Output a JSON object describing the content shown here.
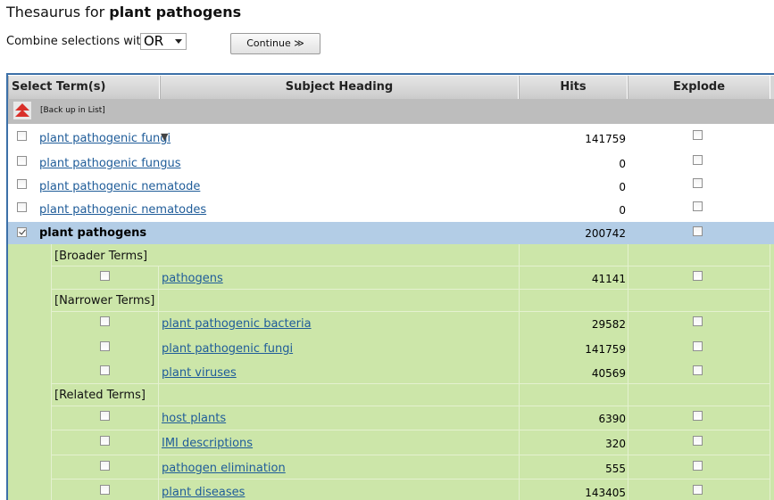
{
  "page": {
    "title_prefix": "Thesaurus for ",
    "title_term": "plant pathogens"
  },
  "controls": {
    "combine_label": "Combine selections with:",
    "combine_value": "OR",
    "continue_label": "Continue ≫"
  },
  "table": {
    "headers": [
      "Select Term(s)",
      "Subject Heading",
      "Hits",
      "Explode"
    ],
    "back_up_label": "[Back up in List]",
    "terms": [
      {
        "label": "plant pathogenic fungi",
        "hits": "141759",
        "has_expand": true
      },
      {
        "label": "plant pathogenic fungus",
        "hits": "0"
      },
      {
        "label": "plant pathogenic nematode",
        "hits": "0"
      },
      {
        "label": "plant pathogenic nematodes",
        "hits": "0"
      }
    ],
    "selected": {
      "label": "plant pathogens",
      "hits": "200742",
      "checked": true
    },
    "broader_label": "[Broader Terms]",
    "broader": [
      {
        "label": "pathogens",
        "hits": "41141"
      }
    ],
    "narrower_label": "[Narrower Terms]",
    "narrower": [
      {
        "label": "plant pathogenic bacteria",
        "hits": "29582"
      },
      {
        "label": "plant pathogenic fungi",
        "hits": "141759"
      },
      {
        "label": "plant viruses",
        "hits": "40569"
      }
    ],
    "related_label": "[Related Terms]",
    "related": [
      {
        "label": "host plants",
        "hits": "6390"
      },
      {
        "label": "IMI descriptions",
        "hits": "320"
      },
      {
        "label": "pathogen elimination",
        "hits": "555"
      },
      {
        "label": "plant diseases",
        "hits": "143405"
      }
    ]
  },
  "colors": {
    "link": "#1f5c99",
    "selected_row": "#b3cde6",
    "related_bg": "#cce6a9",
    "table_border": "#3c70a8",
    "up_arrow": "#d9302a"
  }
}
